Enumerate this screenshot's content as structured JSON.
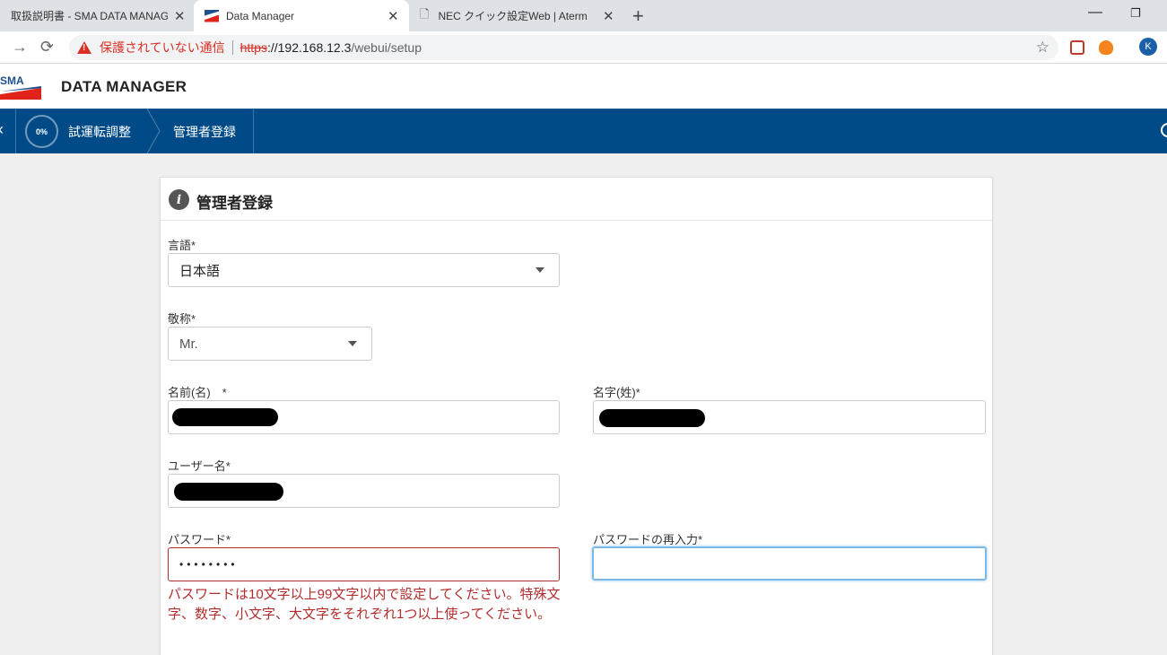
{
  "browser": {
    "tabs": [
      {
        "title": "取扱説明書 - SMA DATA MANAG",
        "favicon": "document-icon"
      },
      {
        "title": "Data Manager",
        "favicon": "sma-icon",
        "active": true
      },
      {
        "title": "NEC クイック設定Web | Aterm",
        "favicon": "document-icon"
      }
    ],
    "new_tab": "+",
    "close_glyph": "✕",
    "address": {
      "security_label": "保護されていない通信",
      "scheme": "https",
      "host": "://192.168.12.3",
      "path": "/webui/setup"
    },
    "profile_initial": "K"
  },
  "app": {
    "logo_text": "SMA",
    "title": "DATA MANAGER"
  },
  "wizard": {
    "progress": "0%",
    "steps": [
      "試運転調整",
      "管理者登録"
    ]
  },
  "form": {
    "title": "管理者登録",
    "language_label": "言語*",
    "language_value": "日本語",
    "salutation_label": "敬称*",
    "salutation_value": "Mr.",
    "first_name_label": "名前(名)　*",
    "last_name_label": "名字(姓)*",
    "username_label": "ユーザー名*",
    "password_label": "パスワード*",
    "password_value": "••••••••",
    "password_confirm_label": "パスワードの再入力*",
    "password_error": "パスワードは10文字以上99文字以内で設定してください。特殊文字、数字、小文字、大文字をそれぞれ1つ以上使ってください。"
  },
  "colors": {
    "brand_blue": "#004b87",
    "error_red": "#b22d2d",
    "warning_red": "#d93025"
  }
}
